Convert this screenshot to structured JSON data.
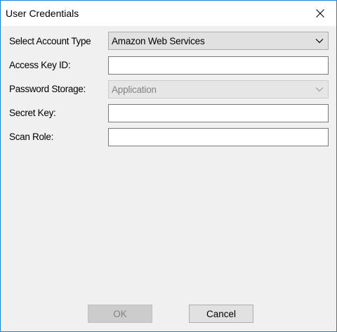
{
  "window": {
    "title": "User Credentials",
    "close_icon": "close-icon"
  },
  "form": {
    "account_type": {
      "label": "Select Account Type",
      "selected": "Amazon Web Services"
    },
    "access_key_id": {
      "label": "Access Key ID:",
      "value": ""
    },
    "password_storage": {
      "label": "Password Storage:",
      "selected": "Application",
      "disabled": true
    },
    "secret_key": {
      "label": "Secret Key:",
      "value": ""
    },
    "scan_role": {
      "label": "Scan Role:",
      "value": ""
    }
  },
  "buttons": {
    "ok_label": "OK",
    "ok_disabled": true,
    "cancel_label": "Cancel"
  },
  "colors": {
    "window_border": "#1883d7",
    "client_bg": "#f0f0f0",
    "disabled_text": "#838383"
  }
}
